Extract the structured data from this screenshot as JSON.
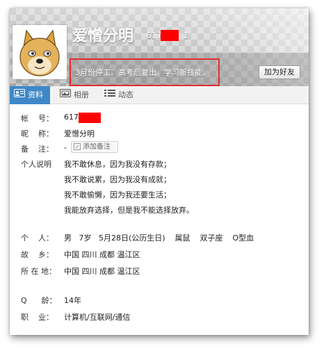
{
  "profile": {
    "nickname": "爱憎分明",
    "qq_number_visible": "617",
    "qq_number_tail": "1",
    "signature": "3月份停工。高考后复出。学习新技能。",
    "add_friend_label": "加为好友"
  },
  "tabs": [
    {
      "label": "资料",
      "icon": "profile-card-icon",
      "active": true
    },
    {
      "label": "相册",
      "icon": "photo-album-icon",
      "active": false
    },
    {
      "label": "动态",
      "icon": "feed-list-icon",
      "active": false
    }
  ],
  "info": {
    "account_label": "帐    号：",
    "account_value": "617",
    "nickname_label": "昵    称：",
    "nickname_value": "爱憎分明",
    "note_label": "备    注：",
    "note_value": "-",
    "add_note_label": "添加备注",
    "bio_label": "个人说明",
    "bio_lines": [
      "我不敢休息，因为我没有存款；",
      "我不敢说累，因为我没有成就；",
      "我不敢偷懒，因为我还要生活；",
      "我能放弃选择，但是我不能选择放弃。"
    ],
    "personal_label": "个    人：",
    "personal_value": "男   7岁   5月28日(公历生日)    属鼠    双子座    O型血",
    "hometown_label": "故    乡：",
    "hometown_value": "中国 四川 成都 温江区",
    "location_label": "所 在 地：",
    "location_value": "中国 四川 成都 温江区",
    "qage_label": "Q      龄：",
    "qage_value": "14年",
    "job_label": "职    业：",
    "job_value": "计算机/互联网/通信"
  },
  "colors": {
    "tab_active": "#3e88c8",
    "highlight_box": "#e52b2b",
    "redaction": "#ff0000"
  }
}
